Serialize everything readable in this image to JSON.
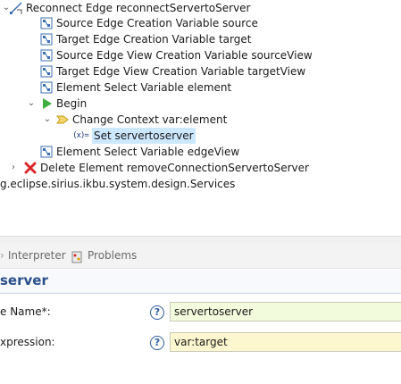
{
  "tree": {
    "items": [
      {
        "label": "Reconnect Edge reconnectServertoServer"
      },
      {
        "label": "Source Edge Creation Variable source"
      },
      {
        "label": "Target Edge Creation Variable target"
      },
      {
        "label": "Source Edge View Creation Variable sourceView"
      },
      {
        "label": "Target Edge View Creation Variable targetView"
      },
      {
        "label": "Element Select Variable element"
      },
      {
        "label": "Begin"
      },
      {
        "label": "Change Context var:element"
      },
      {
        "label": "Set servertoserver",
        "icon_text": "(x)="
      },
      {
        "label": "Element Select Variable edgeView"
      },
      {
        "label": "Delete Element removeConnectionServertoServer"
      },
      {
        "label": "g.eclipse.sirius.ikbu.system.design.Services"
      }
    ]
  },
  "tabs": {
    "interpreter": "Interpreter",
    "problems": "Problems"
  },
  "properties": {
    "title": "server",
    "fields": [
      {
        "label": "e Name*:",
        "value": "servertoserver",
        "help": "?"
      },
      {
        "label": "xpression:",
        "value": "var:target",
        "help": "?"
      }
    ]
  },
  "colors": {
    "selection": "#cce8ff",
    "name_field_bg": "#f3fbdd",
    "expression_field_bg": "#fdf7cf",
    "section_title": "#2a4f8a"
  }
}
